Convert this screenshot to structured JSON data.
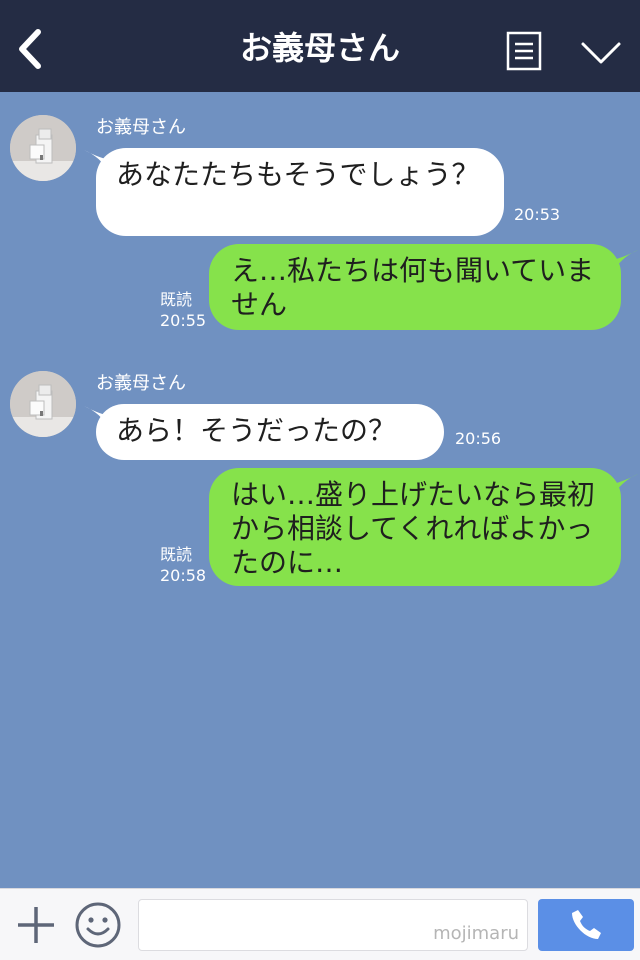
{
  "header": {
    "title": "お義母さん",
    "icons": [
      "chevron-left-icon",
      "menu-list-icon",
      "chevron-down-icon"
    ]
  },
  "messages": [
    {
      "direction": "in",
      "sender": "お義母さん",
      "text": "あなたたちもそうでしょう？",
      "time": "20:53"
    },
    {
      "direction": "out",
      "text": "え…私たちは何も聞いていません",
      "read": "既読",
      "time": "20:55"
    },
    {
      "direction": "in",
      "sender": "お義母さん",
      "text": "あら！そうだったの？",
      "time": "20:56"
    },
    {
      "direction": "out",
      "text": "はい…盛り上げたいなら最初から相談してくれればよかったのに…",
      "read": "既読",
      "time": "20:58"
    }
  ],
  "input_bar": {
    "watermark": "mojimaru",
    "icons": [
      "plus-icon",
      "smiley-icon",
      "phone-icon"
    ]
  },
  "colors": {
    "header_bg": "#242c44",
    "chat_bg": "#7091c1",
    "outgoing_bubble": "#86e24b",
    "incoming_bubble": "#ffffff",
    "call_button": "#5b8fe6"
  }
}
